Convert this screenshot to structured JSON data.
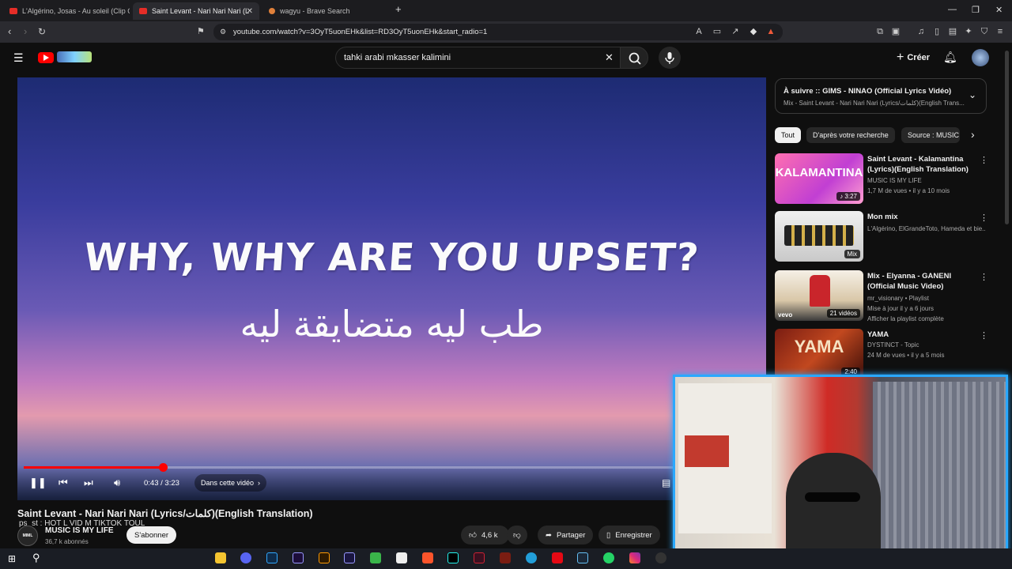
{
  "browser": {
    "tabs": [
      {
        "title": "L'Algérino, Josas - Au soleil (Clip Offi"
      },
      {
        "title": "Saint Levant - Nari Nari Nari (L"
      },
      {
        "title": "wagyu - Brave Search"
      }
    ],
    "new_tab": "+",
    "url": "youtube.com/watch?v=3OyT5uonEHk&list=RD3OyT5uonEHk&start_radio=1"
  },
  "masthead": {
    "search_query": "tahki arabi mkasser kalimini",
    "create_label": "Créer"
  },
  "player": {
    "lyric_en": "WHY, WHY ARE YOU UPSET?",
    "lyric_ar": "طب ليه متضايقة ليه",
    "time": "0:43 / 3:23",
    "progress_fraction": 0.212,
    "chapter": "Dans cette vidéo"
  },
  "video": {
    "title": "Saint Levant - Nari Nari Nari (Lyrics/كلمات)(English Translation)",
    "overlay": "ps_st : HOT L VID M TIKTOK TOUL",
    "channel": "MUSIC IS MY LIFE",
    "subscribers": "36,7 k abonnés",
    "avatar_text": "MIML",
    "subscribe": "S'abonner",
    "likes": "4,6 k",
    "share": "Partager",
    "save": "Enregistrer"
  },
  "sidebar": {
    "up_next_title": "À suivre :: GIMS - NINAO (Official Lyrics Vidéo)",
    "up_next_sub": "Mix - Saint Levant - Nari Nari Nari (Lyrics/كلمات)(English Trans...",
    "chips": [
      "Tout",
      "D'après votre recherche",
      "Source : MUSIC"
    ],
    "recs": [
      {
        "title": "Saint Levant - Kalamantina (Lyrics)(English Translation)",
        "line1": "MUSIC IS MY LIFE",
        "line2": "1,7 M de vues • il y a 10 mois",
        "line3": "",
        "badge": "♪ 3:27",
        "thumb_text": "KALAMANTINA"
      },
      {
        "title": "Mon mix",
        "line1": "L'Algérino, ElGrandeToto, Hameda et bie...",
        "line2": "",
        "line3": "",
        "badge": "Mix",
        "thumb_text": ""
      },
      {
        "title": "Mix - Elyanna - GANENI (Official Music Video)",
        "line1": "mr_visionary • Playlist",
        "line2": "Mise à jour il y a 6 jours",
        "line3": "Afficher la playlist complète",
        "badge": "21 vidéos",
        "thumb_text": "vevo"
      },
      {
        "title": "YAMA",
        "line1": "DYSTINCT - Topic",
        "line2": "24 M de vues • il y a 5 mois",
        "line3": "",
        "badge": "2:40",
        "thumb_text": "YAMA"
      }
    ]
  },
  "colors": {
    "accent": "#ff0000",
    "webcam_border": "#2aa8ff"
  }
}
